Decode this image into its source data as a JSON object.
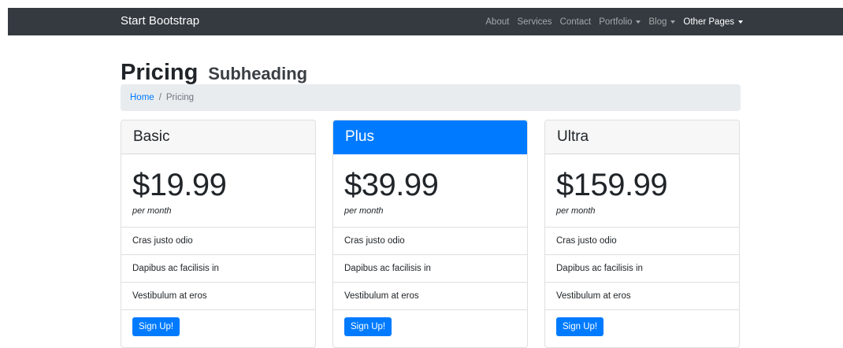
{
  "navbar": {
    "brand": "Start Bootstrap",
    "links": [
      {
        "label": "About"
      },
      {
        "label": "Services"
      },
      {
        "label": "Contact"
      },
      {
        "label": "Portfolio"
      },
      {
        "label": "Blog"
      },
      {
        "label": "Other Pages"
      }
    ]
  },
  "header": {
    "title": "Pricing",
    "subtitle": "Subheading"
  },
  "breadcrumb": {
    "home": "Home",
    "separator": "/",
    "current": "Pricing"
  },
  "plans": [
    {
      "name": "Basic",
      "price": "$19.99",
      "period": "per month",
      "features": [
        "Cras justo odio",
        "Dapibus ac facilisis in",
        "Vestibulum at eros"
      ],
      "button": "Sign Up!"
    },
    {
      "name": "Plus",
      "price": "$39.99",
      "period": "per month",
      "features": [
        "Cras justo odio",
        "Dapibus ac facilisis in",
        "Vestibulum at eros"
      ],
      "button": "Sign Up!"
    },
    {
      "name": "Ultra",
      "price": "$159.99",
      "period": "per month",
      "features": [
        "Cras justo odio",
        "Dapibus ac facilisis in",
        "Vestibulum at eros"
      ],
      "button": "Sign Up!"
    }
  ],
  "colors": {
    "navbar_bg": "#343a40",
    "primary": "#007bff",
    "breadcrumb_bg": "#e9ecef"
  }
}
